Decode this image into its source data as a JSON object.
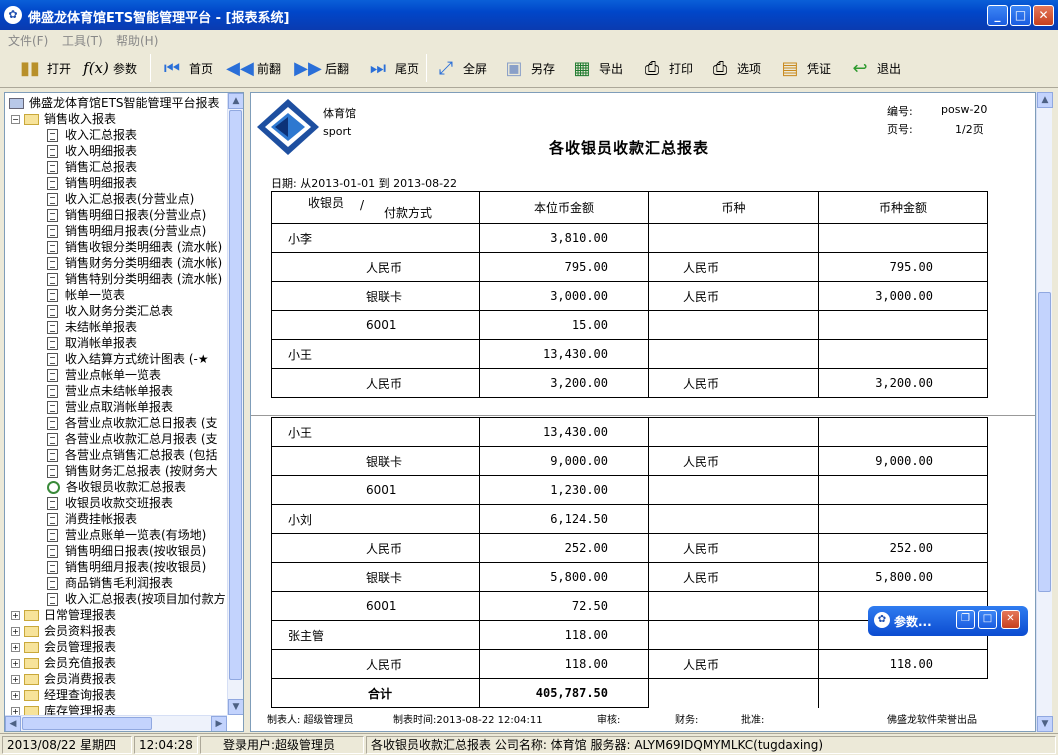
{
  "window": {
    "title": "佛盛龙体育馆ETS智能管理平台 - [报表系统]",
    "icon": "app-icon"
  },
  "menu": [
    "文件(F)",
    "工具(T)",
    "帮助(H)"
  ],
  "toolbar": [
    {
      "label": "打开",
      "icon": "book-icon"
    },
    {
      "label": "参数",
      "icon": "fx-icon"
    },
    {
      "label": "首页",
      "icon": "first-page-icon"
    },
    {
      "label": "前翻",
      "icon": "prev-page-icon"
    },
    {
      "label": "后翻",
      "icon": "next-page-icon"
    },
    {
      "label": "尾页",
      "icon": "last-page-icon"
    },
    {
      "label": "全屏",
      "icon": "fullscreen-icon"
    },
    {
      "label": "另存",
      "icon": "save-as-icon"
    },
    {
      "label": "导出",
      "icon": "excel-icon"
    },
    {
      "label": "打印",
      "icon": "printer-icon"
    },
    {
      "label": "选项",
      "icon": "printer-options-icon"
    },
    {
      "label": "凭证",
      "icon": "voucher-icon"
    },
    {
      "label": "退出",
      "icon": "exit-icon"
    }
  ],
  "tree": {
    "root": "佛盛龙体育馆ETS智能管理平台报表",
    "group": "销售收入报表",
    "items": [
      "收入汇总报表",
      "收入明细报表",
      "销售汇总报表",
      "销售明细报表",
      "收入汇总报表(分营业点)",
      "销售明细日报表(分营业点)",
      "销售明细月报表(分营业点)",
      "销售收银分类明细表 (流水帐)",
      "销售财务分类明细表 (流水帐)",
      "销售特别分类明细表 (流水帐)",
      "帐单一览表",
      "收入财务分类汇总表",
      "未结帐单报表",
      "取消帐单报表",
      "收入结算方式统计图表 (-★",
      "营业点帐单一览表",
      "营业点未结帐单报表",
      "营业点取消帐单报表",
      "各营业点收款汇总日报表 (支",
      "各营业点收款汇总月报表 (支",
      "各营业点销售汇总报表 (包括",
      "销售财务汇总报表 (按财务大",
      "各收银员收款汇总报表",
      "收银员收款交班报表",
      "消费挂帐报表",
      "营业点账单一览表(有场地)",
      "销售明细日报表(按收银员)",
      "销售明细月报表(按收银员)",
      "商品销售毛利润报表",
      "收入汇总报表(按项目加付款方"
    ],
    "selected_index": 22,
    "groups": [
      "日常管理报表",
      "会员资料报表",
      "会员管理报表",
      "会员充值报表",
      "会员消费报表",
      "经理查询报表",
      "库存管理报表"
    ]
  },
  "report": {
    "org": "体育馆",
    "org_en": "sport",
    "code_label": "编号:",
    "code": "posw-20",
    "page_label": "页号:",
    "page": "1/2页",
    "title": "各收银员收款汇总报表",
    "date_range": "日期: 从2013-01-01 到 2013-08-22",
    "headers": {
      "cashier": "收银员",
      "slash": "/",
      "paytype": "付款方式",
      "amount": "本位币金额",
      "currency": "币种",
      "cur_amount": "币种金额"
    },
    "page1_rows": [
      {
        "name": "小李",
        "type": "",
        "amount": "3,810.00",
        "currency": "",
        "cur_amount": ""
      },
      {
        "name": "",
        "type": "人民币",
        "amount": "795.00",
        "currency": "人民币",
        "cur_amount": "795.00"
      },
      {
        "name": "",
        "type": "银联卡",
        "amount": "3,000.00",
        "currency": "人民币",
        "cur_amount": "3,000.00"
      },
      {
        "name": "",
        "type": "6001",
        "amount": "15.00",
        "currency": "",
        "cur_amount": ""
      },
      {
        "name": "小王",
        "type": "",
        "amount": "13,430.00",
        "currency": "",
        "cur_amount": ""
      },
      {
        "name": "",
        "type": "人民币",
        "amount": "3,200.00",
        "currency": "人民币",
        "cur_amount": "3,200.00"
      }
    ],
    "page2_rows": [
      {
        "name": "小王",
        "type": "",
        "amount": "13,430.00",
        "currency": "",
        "cur_amount": ""
      },
      {
        "name": "",
        "type": "银联卡",
        "amount": "9,000.00",
        "currency": "人民币",
        "cur_amount": "9,000.00"
      },
      {
        "name": "",
        "type": "6001",
        "amount": "1,230.00",
        "currency": "",
        "cur_amount": ""
      },
      {
        "name": "小刘",
        "type": "",
        "amount": "6,124.50",
        "currency": "",
        "cur_amount": ""
      },
      {
        "name": "",
        "type": "人民币",
        "amount": "252.00",
        "currency": "人民币",
        "cur_amount": "252.00"
      },
      {
        "name": "",
        "type": "银联卡",
        "amount": "5,800.00",
        "currency": "人民币",
        "cur_amount": "5,800.00"
      },
      {
        "name": "",
        "type": "6001",
        "amount": "72.50",
        "currency": "",
        "cur_amount": ""
      },
      {
        "name": "张主管",
        "type": "",
        "amount": "118.00",
        "currency": "",
        "cur_amount": ""
      },
      {
        "name": "",
        "type": "人民币",
        "amount": "118.00",
        "currency": "人民币",
        "cur_amount": "118.00"
      }
    ],
    "total_label": "合计",
    "total": "405,787.50",
    "footer": {
      "maker": "制表人: 超级管理员",
      "time": "制表时间:2013-08-22 12:04:11",
      "audit": "审核:",
      "finance": "财务:",
      "approve": "批准:",
      "vendor": "佛盛龙软件荣誉出品"
    }
  },
  "param_window": {
    "title": "参数..."
  },
  "status": {
    "date": "2013/08/22 星期四",
    "time": "12:04:28",
    "user": "登录用户:超级管理员",
    "info": "各收银员收款汇总报表 公司名称: 体育馆 服务器: ALYM69IDQMYMLKC(tugdaxing)"
  }
}
